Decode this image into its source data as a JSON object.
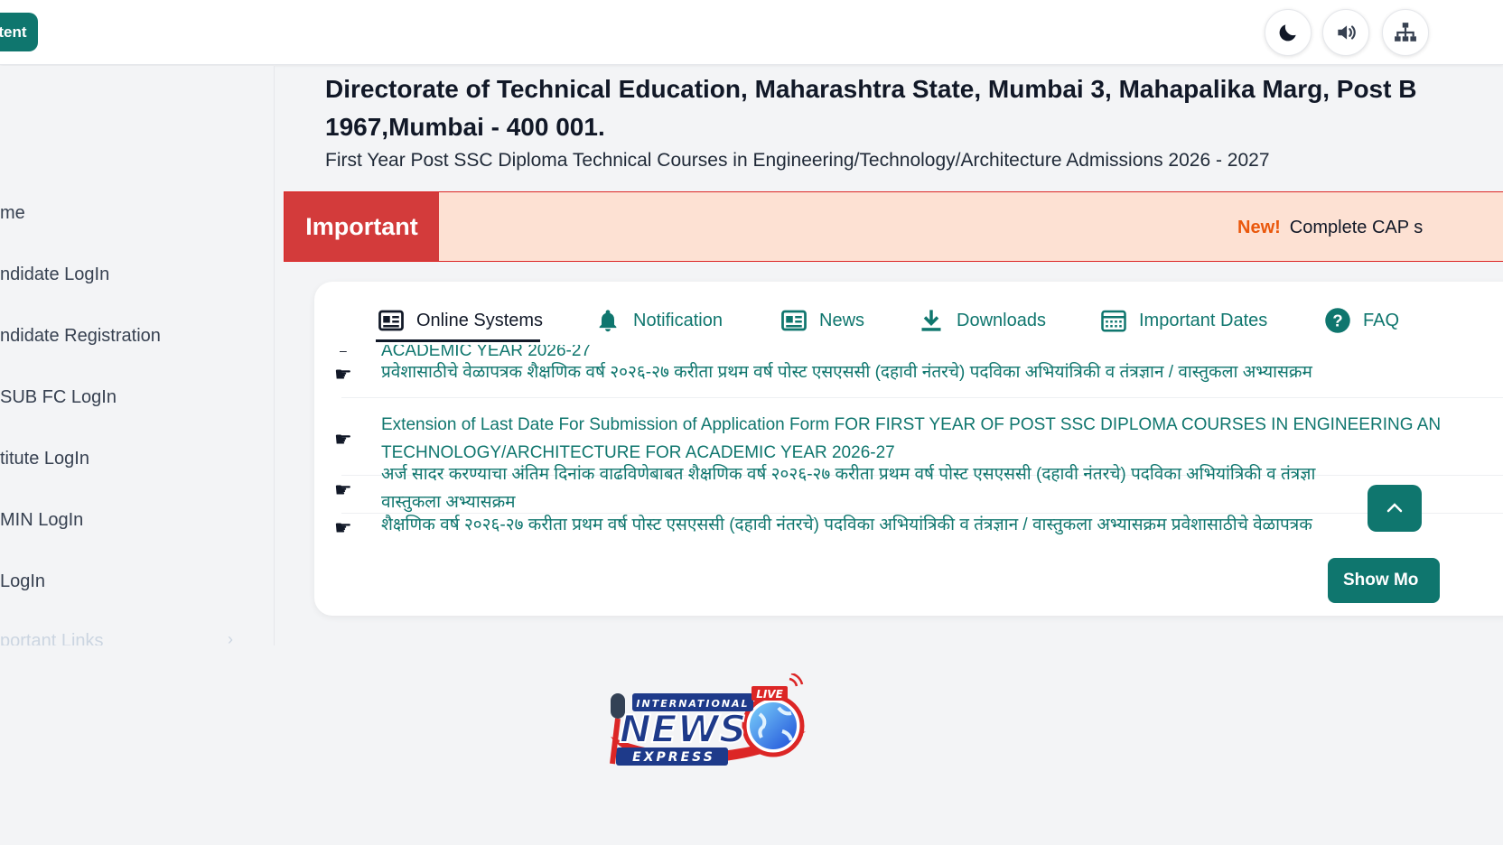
{
  "topbar": {
    "skip_label": "ntent",
    "tools": [
      {
        "name": "moon-icon"
      },
      {
        "name": "speaker-icon"
      },
      {
        "name": "sitemap-icon"
      }
    ]
  },
  "sidebar": {
    "items": [
      {
        "label": "me"
      },
      {
        "label": "ndidate LogIn"
      },
      {
        "label": "ndidate Registration"
      },
      {
        "label": " SUB FC LogIn"
      },
      {
        "label": "titute LogIn"
      },
      {
        "label": "MIN LogIn"
      },
      {
        "label": " LogIn"
      },
      {
        "label": "portant Links"
      }
    ],
    "chevron": "›"
  },
  "header": {
    "title_line1": "Directorate of Technical Education, Maharashtra State, Mumbai 3, Mahapalika Marg, Post B",
    "title_line2": "1967,Mumbai - 400 001.",
    "subtitle": "First Year Post SSC Diploma Technical Courses in Engineering/Technology/Architecture Admissions 2026 - 2027"
  },
  "banner": {
    "label": "Important",
    "new_tag": "New!",
    "text": "Complete CAP s"
  },
  "tabs": [
    {
      "label": "Online Systems",
      "icon": "newspaper-icon",
      "active": true
    },
    {
      "label": "Notification",
      "icon": "bell-icon"
    },
    {
      "label": "News",
      "icon": "newspaper-icon"
    },
    {
      "label": "Downloads",
      "icon": "download-icon"
    },
    {
      "label": "Important Dates",
      "icon": "calendar-icon"
    },
    {
      "label": "FAQ",
      "icon": "question-icon"
    }
  ],
  "notices": [
    {
      "line1": "ACADEMIC YEAR 2026-27",
      "line2": "प्रवेशासाठीचे वेळापत्रक शैक्षणिक वर्ष २०२६-२७ करीता प्रथम वर्ष पोस्ट एसएससी (दहावी नंतरचे) पदविका अभियांत्रिकी व तंत्रज्ञान / वास्तुकला अभ्यासक्रम"
    },
    {
      "line1": "Extension of Last Date For Submission of Application Form FOR FIRST YEAR OF POST SSC DIPLOMA COURSES IN ENGINEERING AN",
      "line2": "TECHNOLOGY/ARCHITECTURE FOR ACADEMIC YEAR 2026-27"
    },
    {
      "line1": "अर्ज सादर करण्याचा अंतिम दिनांक वाढविणेबाबत शैक्षणिक वर्ष २०२६-२७ करीता प्रथम वर्ष पोस्ट एसएससी (दहावी नंतरचे) पदविका अभियांत्रिकी व तंत्रज्ञा",
      "line2": "वास्तुकला अभ्यासक्रम"
    },
    {
      "line1": "शैक्षणिक वर्ष २०२६-२७ करीता प्रथम वर्ष पोस्ट एसएससी (दहावी नंतरचे) पदविका अभियांत्रिकी व तंत्रज्ञान / वास्तुकला अभ्यासक्रम प्रवेशासाठीचे वेळापत्रक"
    }
  ],
  "show_more_label": "Show Mo",
  "logo": {
    "live": "LIVE",
    "top": "INTERNATIONAL",
    "main": "NEWS",
    "bottom": "EXPRESS"
  },
  "colors": {
    "brand": "#0f766e",
    "important": "#d33b3b",
    "banner_bg": "#fde1d3",
    "new_tag": "#ea580c"
  }
}
